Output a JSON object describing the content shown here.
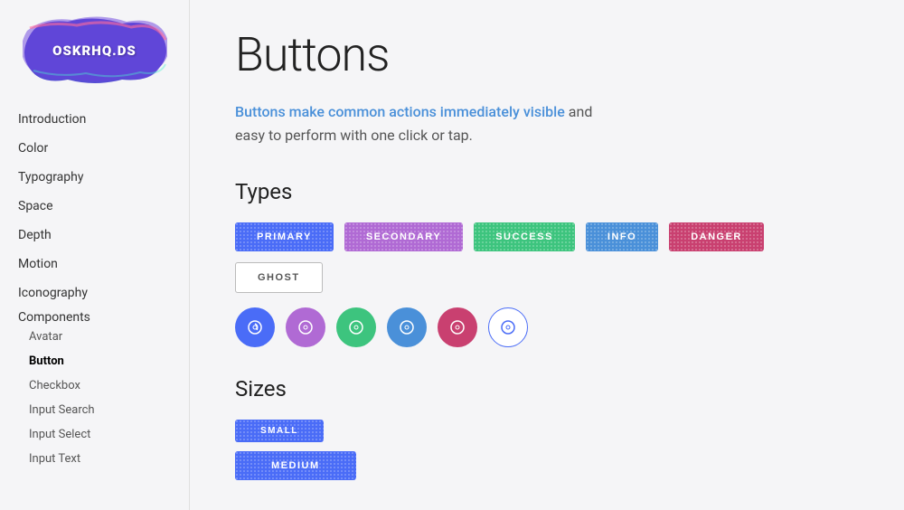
{
  "logo": {
    "text": "OSKRHQ.DS"
  },
  "sidebar": {
    "nav": [
      {
        "label": "Introduction",
        "type": "item",
        "active": false
      },
      {
        "label": "Color",
        "type": "item",
        "active": false
      },
      {
        "label": "Typography",
        "type": "item",
        "active": false
      },
      {
        "label": "Space",
        "type": "item",
        "active": false
      },
      {
        "label": "Depth",
        "type": "item",
        "active": false
      },
      {
        "label": "Motion",
        "type": "item",
        "active": false
      },
      {
        "label": "Iconography",
        "type": "item",
        "active": false
      },
      {
        "label": "Components",
        "type": "section",
        "active": false
      },
      {
        "label": "Avatar",
        "type": "sub",
        "active": false
      },
      {
        "label": "Button",
        "type": "sub",
        "active": true
      },
      {
        "label": "Checkbox",
        "type": "sub",
        "active": false
      },
      {
        "label": "Input Search",
        "type": "sub",
        "active": false
      },
      {
        "label": "Input Select",
        "type": "sub",
        "active": false
      },
      {
        "label": "Input Text",
        "type": "sub",
        "active": false
      }
    ]
  },
  "main": {
    "title": "Buttons",
    "description_part1": "Buttons make common actions immediately",
    "description_highlight": "visible",
    "description_part2": "and easy to perform with one click or tap.",
    "sections": {
      "types": {
        "label": "Types",
        "buttons": [
          {
            "label": "PRIMARY",
            "variant": "primary"
          },
          {
            "label": "SECONDARY",
            "variant": "secondary"
          },
          {
            "label": "SUCCESS",
            "variant": "success"
          },
          {
            "label": "INFO",
            "variant": "info"
          },
          {
            "label": "DANGER",
            "variant": "danger"
          },
          {
            "label": "GHOST",
            "variant": "ghost"
          }
        ],
        "icon_buttons": [
          {
            "variant": "primary",
            "icon": "↻"
          },
          {
            "variant": "secondary",
            "icon": "↻"
          },
          {
            "variant": "success",
            "icon": "↻"
          },
          {
            "variant": "info",
            "icon": "↻"
          },
          {
            "variant": "danger",
            "icon": "↻"
          },
          {
            "variant": "ghost",
            "icon": "↻"
          }
        ]
      },
      "sizes": {
        "label": "Sizes",
        "buttons": [
          {
            "label": "SMALL",
            "size": "small"
          },
          {
            "label": "MEDIUM",
            "size": "medium"
          }
        ]
      }
    }
  }
}
